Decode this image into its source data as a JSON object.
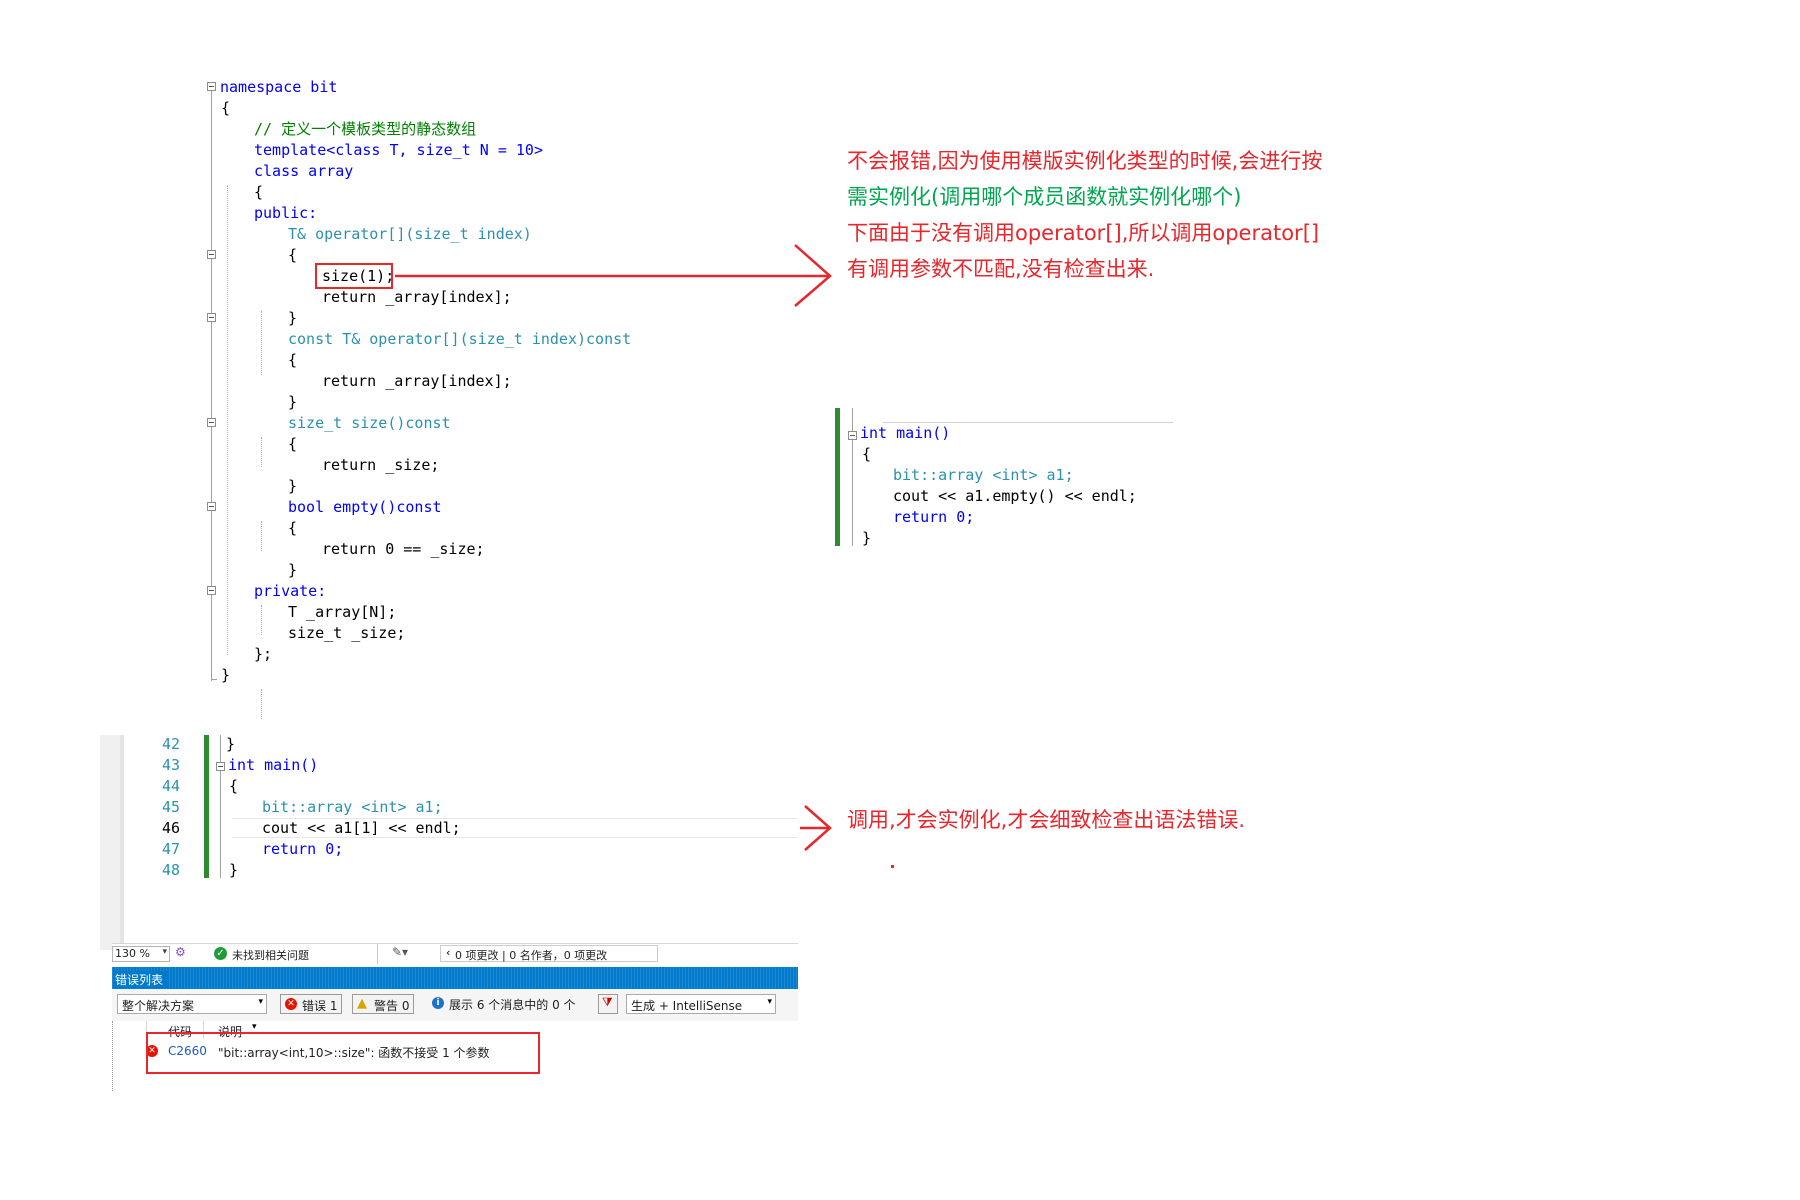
{
  "code_top": {
    "lines": [
      "namespace bit",
      "{",
      "// 定义一个模板类型的静态数组",
      "template<class T, size_t N = 10>",
      "class array",
      "{",
      "public:",
      "T& operator[](size_t index)",
      "{",
      "size(1);",
      "return _array[index];",
      "}",
      "const T& operator[](size_t index)const",
      "{",
      "return _array[index];",
      "}",
      "size_t size()const",
      "{",
      "return _size;",
      "}",
      "bool empty()const",
      "{",
      "return 0 == _size;",
      "}",
      "private:",
      "T _array[N];",
      "size_t _size;",
      "};",
      "}"
    ]
  },
  "code_right": {
    "lines": [
      "int main()",
      "{",
      "bit::array <int> a1;",
      "cout << a1.empty() << endl;",
      "return 0;",
      "}"
    ]
  },
  "code_bottom": {
    "line_numbers": [
      "42",
      "43",
      "44",
      "45",
      "46",
      "47",
      "48"
    ],
    "lines": [
      "}",
      "int main()",
      "{",
      "bit::array <int> a1;",
      "cout << a1[1] << endl;",
      "return 0;",
      "}"
    ]
  },
  "annotations": {
    "note1_line1": "不会报错,因为使用模版实例化类型的时候,会进行按",
    "note1_line2": "需实例化(调用哪个成员函数就实例化哪个)",
    "note1_line3": "下面由于没有调用operator[],所以调用operator[]",
    "note1_line4": "有调用参数不匹配,没有检查出来.",
    "note2": "调用,才会实例化,才会细致检查出语法错误."
  },
  "status_bar": {
    "zoom": "130 %",
    "no_issues": "未找到相关问题",
    "changes": "0 项更改 | 0 名作者，0 项更改"
  },
  "error_list": {
    "title": "错误列表",
    "scope": "整个解决方案",
    "errors_label": "错误 1",
    "warnings_label": "警告 0",
    "messages_label": "展示 6 个消息中的 0 个",
    "build_filter": "生成 + IntelliSense",
    "col_code": "代码",
    "col_desc": "说明",
    "row_code": "C2660",
    "row_desc": "\"bit::array<int,10>::size\": 函数不接受 1 个参数"
  },
  "colors": {
    "annotation_red": "#e8262b",
    "annotation_green": "#00a650",
    "keyword_blue": "#0000ff",
    "type_teal": "#2b91af",
    "comment_green": "#008000",
    "vs_blue": "#007acc",
    "changed_bar_green": "#2e8b2e"
  }
}
